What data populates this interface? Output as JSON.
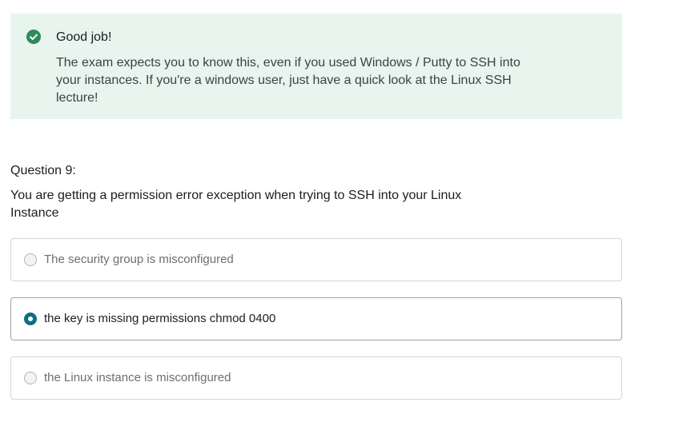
{
  "feedback": {
    "icon": "check-circle-icon",
    "title": "Good job!",
    "body": "The exam expects you to know this, even if you used Windows / Putty to SSH into your instances. If you're a windows user, just have a quick look at the Linux SSH lecture!"
  },
  "question": {
    "number_label": "Question 9:",
    "text": "You are getting a permission error exception when trying to SSH into your Linux Instance"
  },
  "answers": [
    {
      "label": "The security group is misconfigured",
      "selected": false
    },
    {
      "label": "the key is missing permissions chmod 0400",
      "selected": true
    },
    {
      "label": "the Linux instance is misconfigured",
      "selected": false
    }
  ],
  "colors": {
    "feedback_bg": "#e8f4ee",
    "success": "#2e8b57",
    "radio_selected": "#0e6e82"
  }
}
